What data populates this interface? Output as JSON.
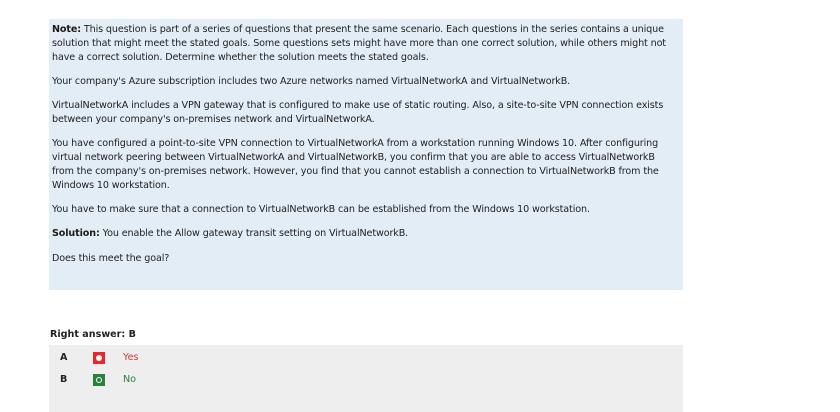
{
  "question": {
    "note_label": "Note:",
    "note_text": " This question is part of a series of questions that present the same scenario. Each questions in the series contains a unique solution that might meet the stated goals. Some questions sets might have more than one correct solution, while others might not have a correct solution. Determine whether the solution meets the stated goals.",
    "paragraph1": "Your company's Azure subscription includes two Azure networks named VirtualNetworkA and VirtualNetworkB.",
    "paragraph2": "VirtualNetworkA includes a VPN gateway that is configured to make use of static routing. Also, a site-to-site VPN connection exists between your company's on-premises network and VirtualNetworkA.",
    "paragraph3": "You have configured a point-to-site VPN connection to VirtualNetworkA from a workstation running Windows 10. After configuring virtual network peering between VirtualNetworkA and VirtualNetworkB, you confirm that you are able to access VirtualNetworkB from the company's on-premises network. However, you find that you cannot establish a connection to VirtualNetworkB from the Windows 10 workstation.",
    "paragraph4": "You have to make sure that a connection to VirtualNetworkB can be established from the Windows 10 workstation.",
    "solution_label": "Solution:",
    "solution_text": " You enable the Allow gateway transit setting on VirtualNetworkB.",
    "prompt": "Does this meet the goal?"
  },
  "right_answer": {
    "text": "Right answer: B"
  },
  "options": [
    {
      "letter": "A",
      "text": "Yes",
      "state": "wrong",
      "icon": "incorrect-radio-icon",
      "color": "#e8262c"
    },
    {
      "letter": "B",
      "text": "No",
      "state": "correct",
      "icon": "correct-radio-icon",
      "color": "#27823c"
    }
  ],
  "colors": {
    "question_bg": "#e3edf6",
    "answers_bg": "#eeeeee"
  }
}
